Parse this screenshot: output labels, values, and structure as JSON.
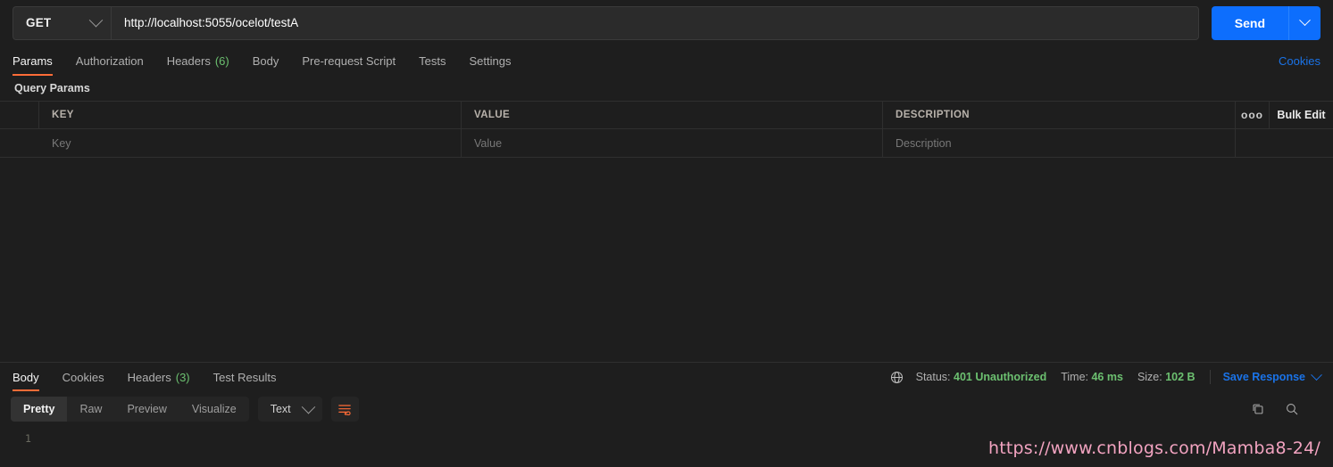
{
  "request": {
    "method": "GET",
    "url": "http://localhost:5055/ocelot/testA",
    "send_label": "Send",
    "tabs": [
      {
        "label": "Params",
        "count": "",
        "active": true
      },
      {
        "label": "Authorization",
        "count": "",
        "active": false
      },
      {
        "label": "Headers",
        "count": "(6)",
        "active": false
      },
      {
        "label": "Body",
        "count": "",
        "active": false
      },
      {
        "label": "Pre-request Script",
        "count": "",
        "active": false
      },
      {
        "label": "Tests",
        "count": "",
        "active": false
      },
      {
        "label": "Settings",
        "count": "",
        "active": false
      }
    ],
    "cookies_link": "Cookies"
  },
  "query_params": {
    "section_title": "Query Params",
    "headers": {
      "key": "KEY",
      "value": "VALUE",
      "description": "DESCRIPTION",
      "dots": "ooo",
      "bulk_edit": "Bulk Edit"
    },
    "rows": [
      {
        "key_placeholder": "Key",
        "value_placeholder": "Value",
        "description_placeholder": "Description"
      }
    ]
  },
  "response": {
    "tabs": [
      {
        "label": "Body",
        "count": "",
        "active": true
      },
      {
        "label": "Cookies",
        "count": "",
        "active": false
      },
      {
        "label": "Headers",
        "count": "(3)",
        "active": false
      },
      {
        "label": "Test Results",
        "count": "",
        "active": false
      }
    ],
    "status_label": "Status:",
    "status_value": "401 Unauthorized",
    "time_label": "Time:",
    "time_value": "46 ms",
    "size_label": "Size:",
    "size_value": "102 B",
    "save_response": "Save Response",
    "view_modes": [
      {
        "label": "Pretty",
        "active": true
      },
      {
        "label": "Raw",
        "active": false
      },
      {
        "label": "Preview",
        "active": false
      },
      {
        "label": "Visualize",
        "active": false
      }
    ],
    "format": "Text",
    "line_numbers": [
      "1"
    ],
    "body_text": ""
  },
  "watermark": "https://www.cnblogs.com/Mamba8-24/",
  "colors": {
    "accent_orange": "#ff6c37",
    "link_blue": "#1a73e8",
    "send_blue": "#0d6efd",
    "success_green": "#6cc070",
    "background": "#1e1e1e",
    "watermark_pink": "#f2a3c0"
  }
}
